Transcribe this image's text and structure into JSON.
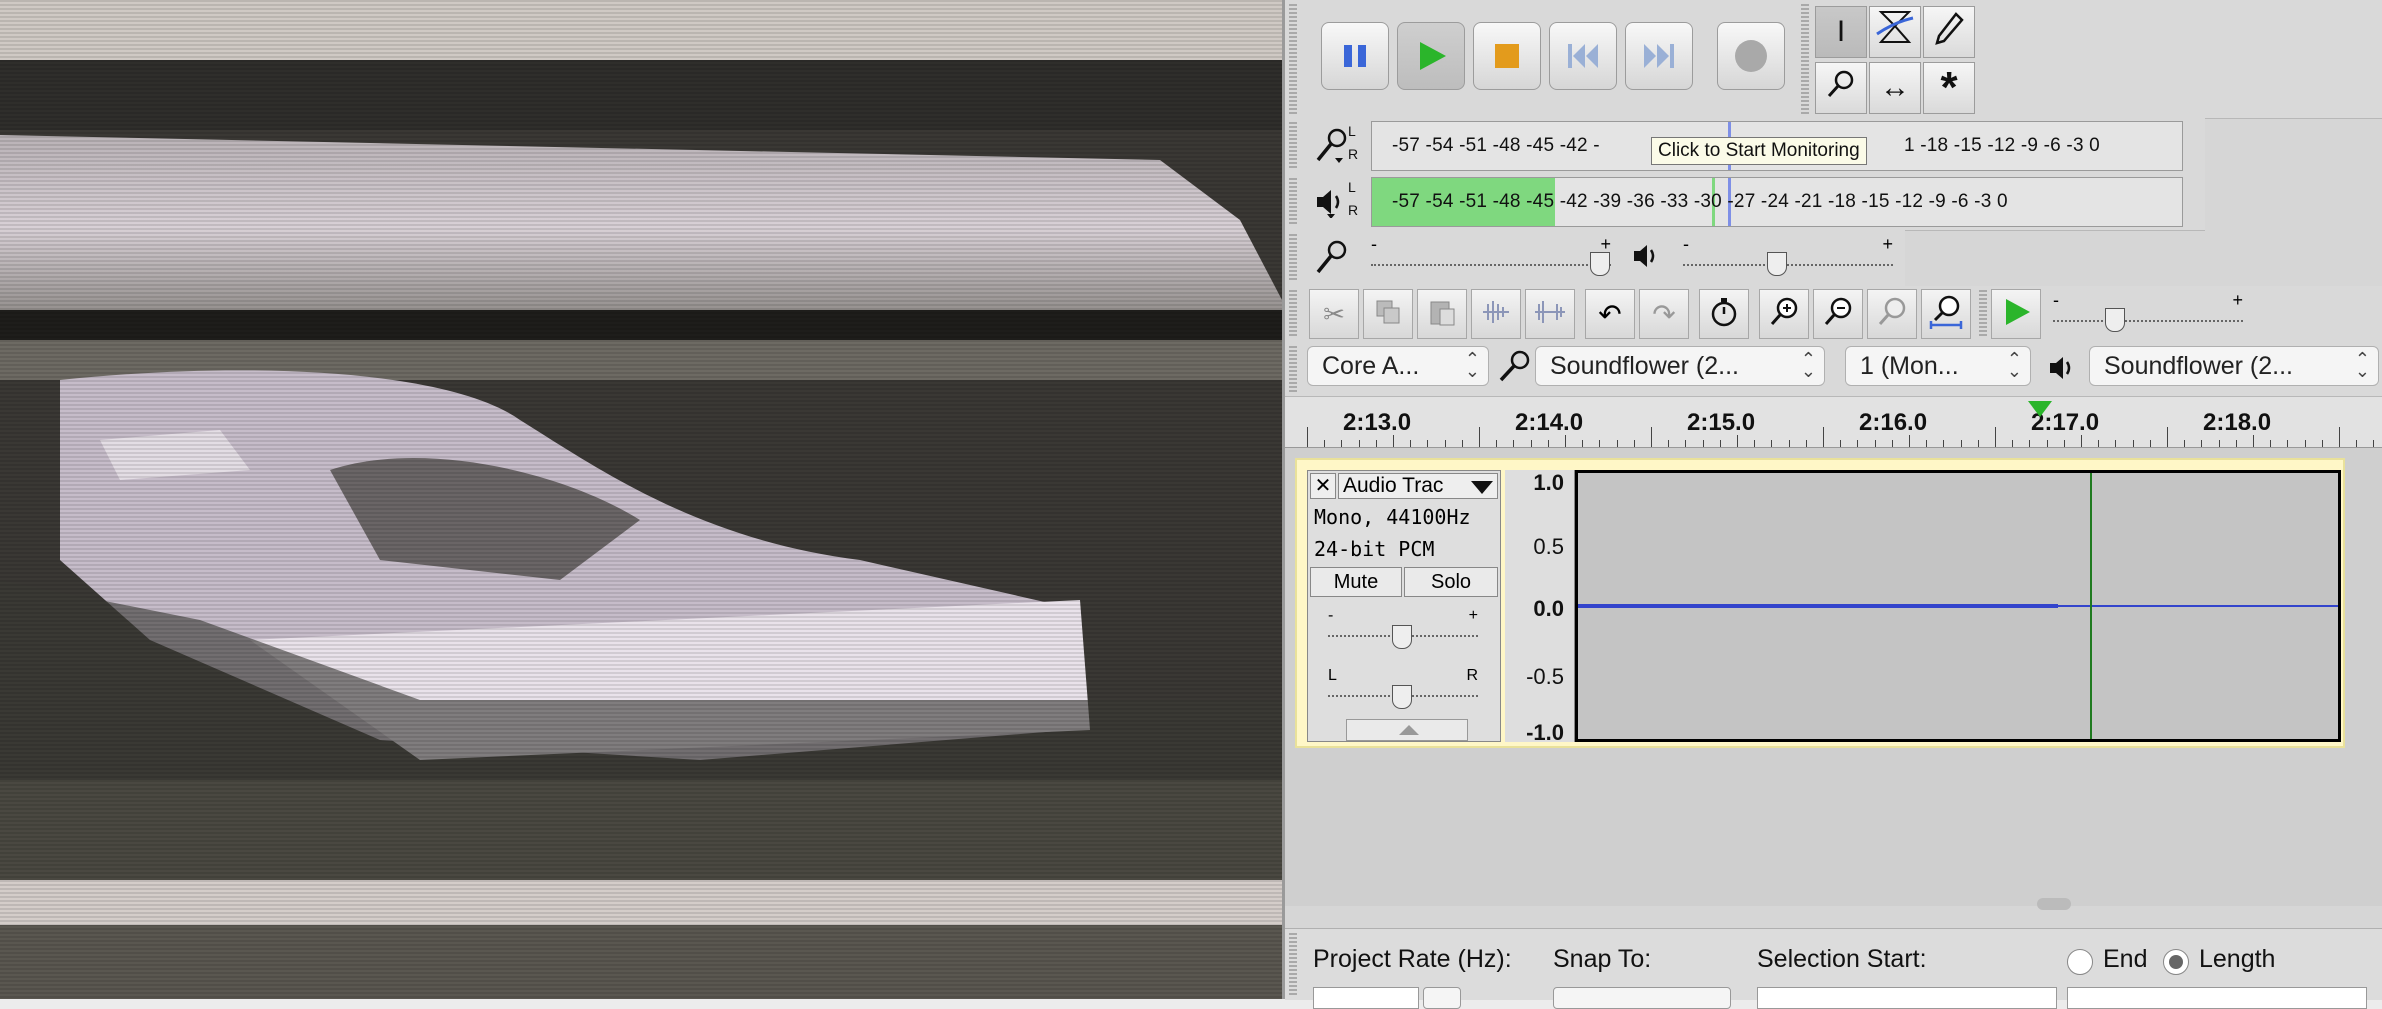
{
  "video": {
    "description_icon": "video-frame-icon"
  },
  "transport": {
    "buttons": [
      "pause",
      "play",
      "stop",
      "skip-to-start",
      "skip-to-end",
      "record"
    ]
  },
  "tools": [
    "selection-tool",
    "envelope-tool",
    "draw-tool",
    "zoom-tool",
    "time-shift-tool",
    "multi-tool"
  ],
  "meters": {
    "record_ticks": "-57 -54 -51 -48 -45 -42 -",
    "record_ticks_right": "1 -18 -15 -12  -9   -6   -3   0",
    "playback_ticks": "-57 -54 -51 -48 -45 -42 -39 -36 -33 -30 -27 -24 -21 -18 -15 -12  -9   -6   -3   0",
    "channel_l": "L",
    "channel_r": "R",
    "tooltip": "Click to Start Monitoring"
  },
  "mixer": {
    "minus": "-",
    "plus": "+"
  },
  "devices": {
    "host": "Core A...",
    "recording_device": "Soundflower (2...",
    "channels": "1 (Mon...",
    "playback_device": "Soundflower (2..."
  },
  "ruler": {
    "labels": [
      "2:13.0",
      "2:14.0",
      "2:15.0",
      "2:16.0",
      "2:17.0",
      "2:18.0"
    ]
  },
  "track": {
    "name": "Audio Trac",
    "format": "Mono, 44100Hz",
    "bit_depth": "24-bit PCM",
    "mute": "Mute",
    "solo": "Solo",
    "gain_minus": "-",
    "gain_plus": "+",
    "pan_left": "L",
    "pan_right": "R",
    "scale": [
      "1.0",
      "0.5",
      "0.0",
      "-0.5",
      "-1.0"
    ]
  },
  "selection_bar": {
    "project_rate_label": "Project Rate (Hz):",
    "snap_to_label": "Snap To:",
    "selection_start_label": "Selection Start:",
    "end_label": "End",
    "length_label": "Length",
    "length_selected": true
  },
  "colors": {
    "meter_green": "#7fd87f",
    "waveform_blue": "#3344cc",
    "track_border": "#e9e19a",
    "play_green": "#2bb52b",
    "stop_orange": "#e39b1c",
    "pause_blue": "#3a66d8"
  }
}
